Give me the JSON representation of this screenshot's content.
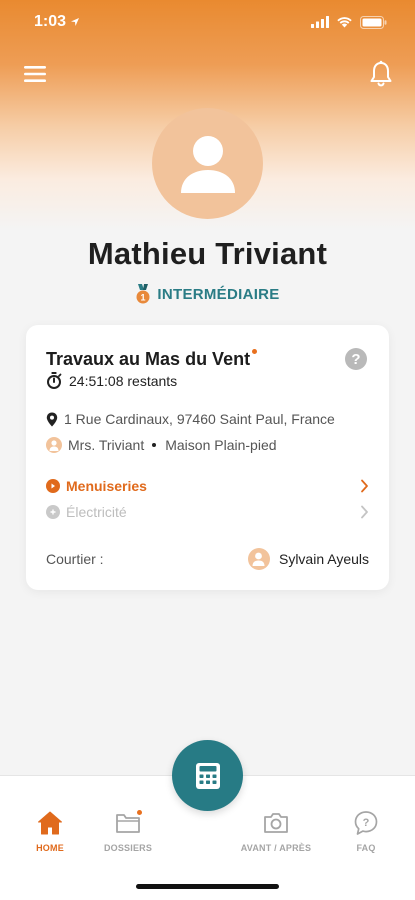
{
  "status_bar": {
    "time": "1:03"
  },
  "profile": {
    "name": "Mathieu Triviant",
    "level": "INTERMÉDIAIRE"
  },
  "project_card": {
    "title": "Travaux au Mas du Vent",
    "timer": "24:51:08 restants",
    "address": "1 Rue Cardinaux, 97460 Saint Paul, France",
    "owner": "Mrs. Triviant",
    "house_type": "Maison Plain-pied",
    "trades": [
      {
        "label": "Menuiseries",
        "active": true
      },
      {
        "label": "Électricité",
        "active": false
      }
    ],
    "broker_label": "Courtier :",
    "broker_name": "Sylvain Ayeuls"
  },
  "tabbar": {
    "tabs": [
      {
        "label": "HOME",
        "icon": "home-icon",
        "active": true
      },
      {
        "label": "DOSSIERS",
        "icon": "folder-icon",
        "active": false
      },
      {
        "label": "AVANT / APRÈS",
        "icon": "camera-icon",
        "active": false
      },
      {
        "label": "FAQ",
        "icon": "help-bubble-icon",
        "active": false
      }
    ],
    "fab_icon": "calculator-icon"
  },
  "colors": {
    "accent_orange": "#e06a1c",
    "teal": "#277b85",
    "avatar_peach": "#f2c39b"
  }
}
